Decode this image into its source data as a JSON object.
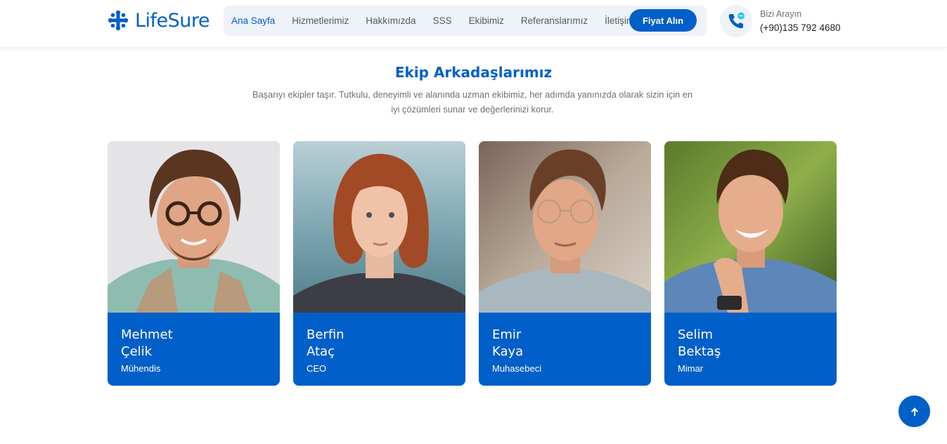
{
  "header": {
    "brand": "LifeSure",
    "nav": [
      {
        "label": "Ana Sayfa",
        "active": true
      },
      {
        "label": "Hizmetlerimiz",
        "active": false
      },
      {
        "label": "Hakkımızda",
        "active": false
      },
      {
        "label": "SSS",
        "active": false
      },
      {
        "label": "Ekibimiz",
        "active": false
      },
      {
        "label": "Referanslarımız",
        "active": false
      },
      {
        "label": "İletişim",
        "active": false
      }
    ],
    "cta_label": "Fiyat Alın",
    "call_label": "Bizi Arayın",
    "call_phone": "(+90)135 792 4680"
  },
  "section": {
    "title": "Ekip Arkadaşlarımız",
    "description": "Başarıyı ekipler taşır. Tutkulu, deneyimli ve alanında uzman ekibimiz, her adımda yanınızda olarak sizin için en iyi çözümleri sunar ve değerlerinizi korur."
  },
  "team": [
    {
      "first": "Mehmet",
      "last": "Çelik",
      "role": "Mühendis"
    },
    {
      "first": "Berfin",
      "last": "Ataç",
      "role": "CEO"
    },
    {
      "first": "Emir",
      "last": "Kaya",
      "role": "Muhasebeci"
    },
    {
      "first": "Selim",
      "last": "Bektaş",
      "role": "Mimar"
    }
  ],
  "colors": {
    "accent": "#015fc9",
    "nav_bg": "#eef2f9"
  },
  "icons": {
    "logo": "cross-dots-logo-icon",
    "call": "phone-chat-icon",
    "scroll_top": "arrow-up-icon"
  }
}
